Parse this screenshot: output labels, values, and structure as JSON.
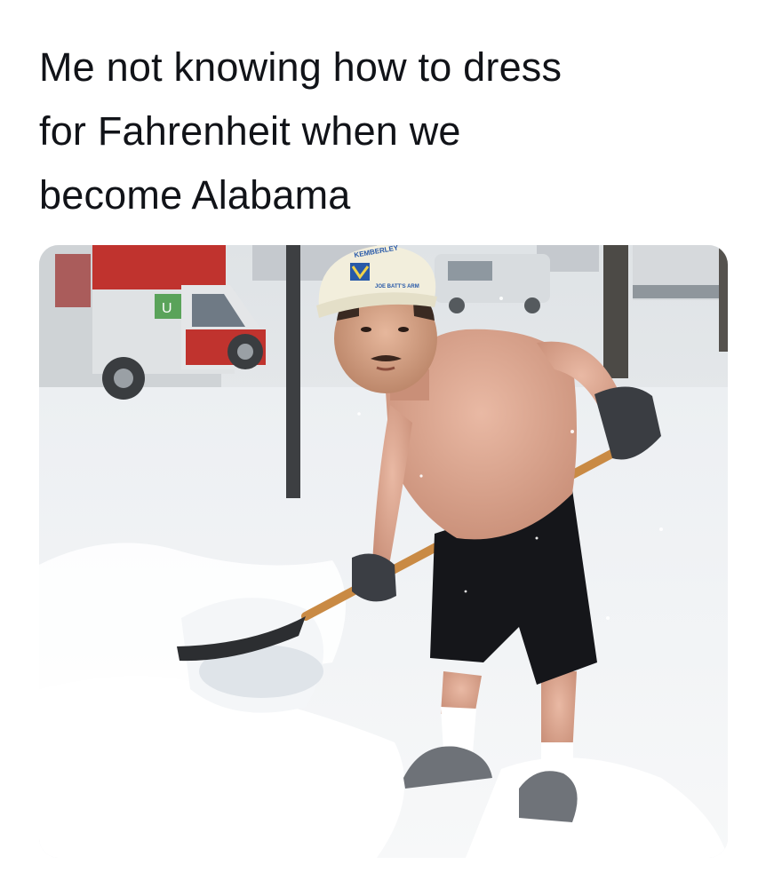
{
  "post": {
    "caption_lines": [
      "Me not knowing how to dress",
      "for Fahrenheit when we",
      "become Alabama"
    ]
  },
  "photo": {
    "hat_text_top": "KEMBERLEY",
    "hat_text_bottom": "JOE BATT'S ARM",
    "truck_sign": "U"
  }
}
